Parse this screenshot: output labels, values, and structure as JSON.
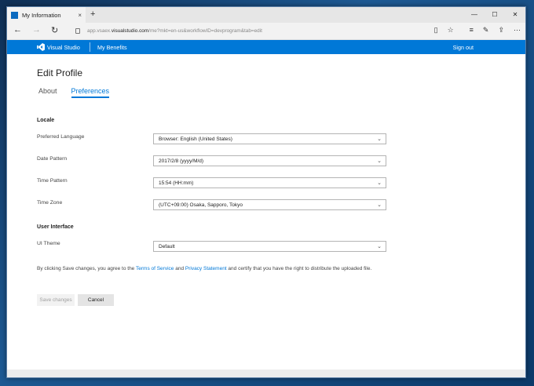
{
  "browser": {
    "tab_title": "My Information",
    "tab_close": "×",
    "new_tab": "+",
    "win_min": "—",
    "win_max": "☐",
    "win_close": "✕",
    "url_prefix": "app.vsaex.",
    "url_domain": "visualstudio.com",
    "url_path": "/me?mkt=en-us&workflowID=devprogram&tab=edit"
  },
  "site_header": {
    "brand": "Visual Studio",
    "nav_item": "My Benefits",
    "sign_out": "Sign out"
  },
  "page": {
    "title": "Edit Profile",
    "tabs": [
      {
        "label": "About",
        "active": false
      },
      {
        "label": "Preferences",
        "active": true
      }
    ]
  },
  "locale": {
    "heading": "Locale",
    "fields": [
      {
        "label": "Preferred Language",
        "value": "Browser: English (United States)"
      },
      {
        "label": "Date Pattern",
        "value": "2017/2/8 (yyyy/M/d)"
      },
      {
        "label": "Time Pattern",
        "value": "15:54 (HH:mm)"
      },
      {
        "label": "Time Zone",
        "value": "(UTC+09:00) Osaka, Sapporo, Tokyo"
      }
    ]
  },
  "ui": {
    "heading": "User Interface",
    "theme_label": "UI Theme",
    "theme_value": "Default"
  },
  "legal": {
    "before": "By clicking Save changes, you agree to the ",
    "terms": "Terms of Service",
    "and": " and ",
    "privacy": "Privacy Statement",
    "after": " and certify that you have the right to distribute the uploaded file."
  },
  "actions": {
    "save": "Save changes",
    "cancel": "Cancel"
  },
  "colors": {
    "accent": "#0078d7"
  }
}
